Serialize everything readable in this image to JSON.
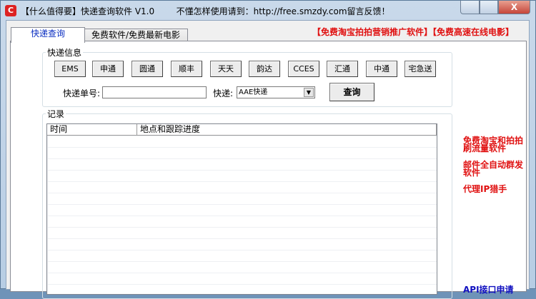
{
  "window": {
    "title": "【什么值得要】快递查询软件 V1.0        不懂怎样使用请到：http://free.smzdy.com留言反馈！",
    "close": "X"
  },
  "tabs": [
    {
      "label": "快递查询"
    },
    {
      "label": "免费软件/免费最新电影"
    }
  ],
  "ad_top": "【免费淘宝拍拍营销推广软件】【免费高速在线电影】",
  "info_group": {
    "label": "快递信息",
    "buttons": [
      "EMS",
      "申通",
      "圆通",
      "顺丰",
      "天天",
      "韵达",
      "CCES",
      "汇通",
      "中通",
      "宅急送"
    ],
    "number_label": "快递单号:",
    "number_value": "",
    "courier_label": "快递:",
    "courier_selected": "AAE快递",
    "query": "查询"
  },
  "records": {
    "label": "记录",
    "columns": [
      "时间",
      "地点和跟踪进度"
    ]
  },
  "side_links": [
    "免费淘宝和拍拍刷流量软件",
    "邮件全自动群发软件",
    "代理IP猎手",
    "API接口申请"
  ]
}
